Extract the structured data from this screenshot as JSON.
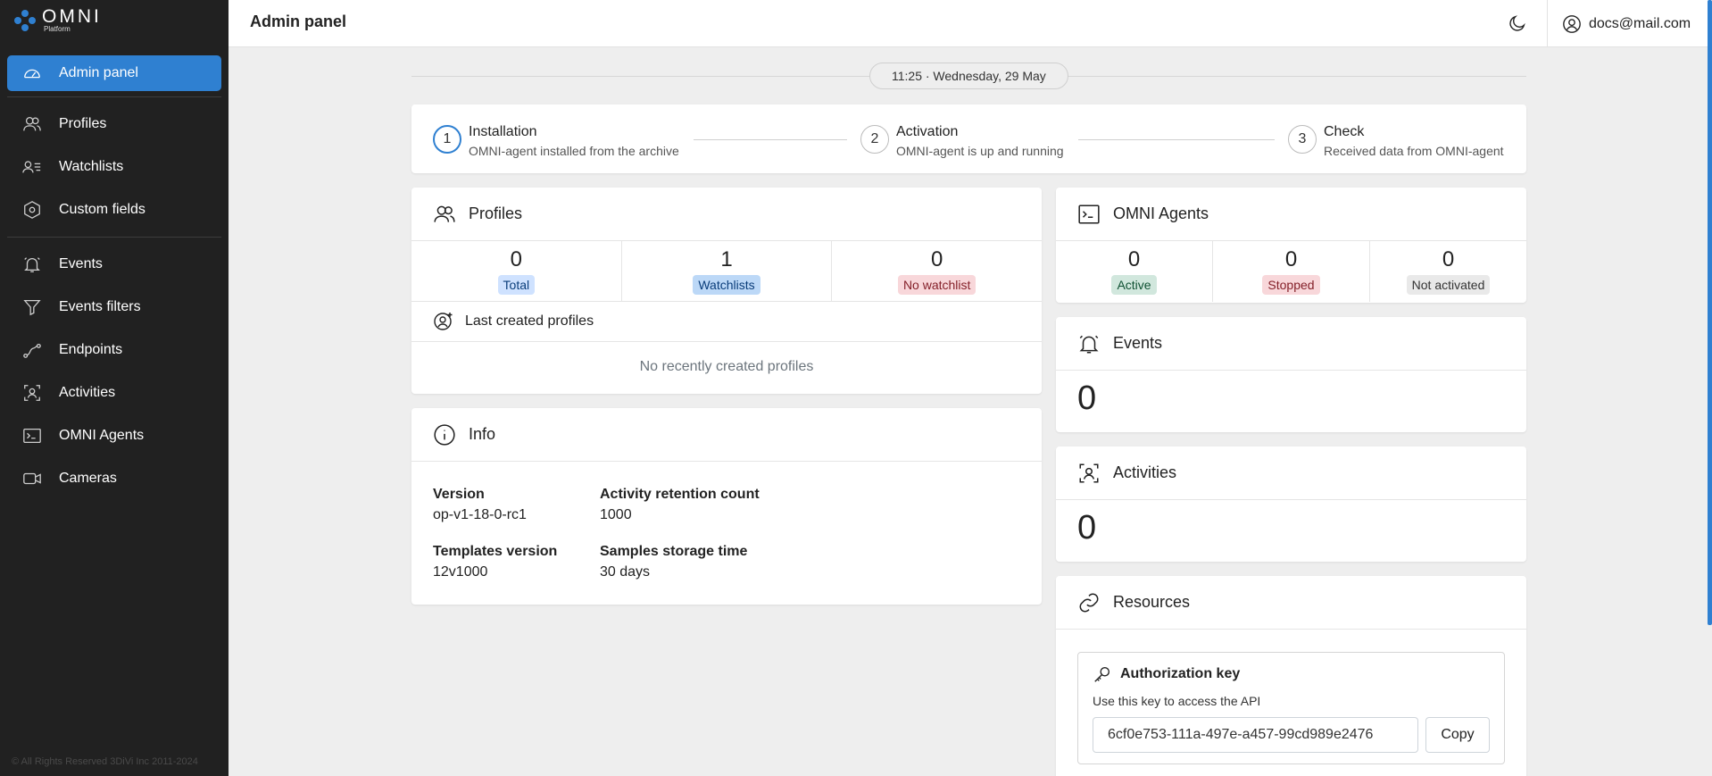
{
  "sidebar": {
    "logo": {
      "name": "OMNI",
      "sub": "Platform"
    },
    "items": [
      {
        "label": "Admin panel",
        "icon": "gauge-icon",
        "active": true
      },
      {
        "label": "Profiles",
        "icon": "users-icon"
      },
      {
        "label": "Watchlists",
        "icon": "list-user-icon"
      },
      {
        "label": "Custom fields",
        "icon": "hexagon-icon"
      },
      {
        "label": "Events",
        "icon": "bell-icon"
      },
      {
        "label": "Events filters",
        "icon": "filter-icon"
      },
      {
        "label": "Endpoints",
        "icon": "route-icon"
      },
      {
        "label": "Activities",
        "icon": "scan-user-icon"
      },
      {
        "label": "OMNI Agents",
        "icon": "terminal-icon"
      },
      {
        "label": "Cameras",
        "icon": "camera-icon"
      }
    ],
    "copyright": "© All Rights Reserved 3DiVi Inc 2011-2024"
  },
  "header": {
    "title": "Admin panel",
    "user": "docs@mail.com"
  },
  "date": "11:25 · Wednesday, 29 May",
  "steps": [
    {
      "num": "1",
      "title": "Installation",
      "sub": "OMNI-agent installed from the archive"
    },
    {
      "num": "2",
      "title": "Activation",
      "sub": "OMNI-agent is up and running"
    },
    {
      "num": "3",
      "title": "Check",
      "sub": "Received data from OMNI-agent"
    }
  ],
  "profiles": {
    "title": "Profiles",
    "stats": [
      {
        "value": "0",
        "label": "Total",
        "bg": "#cfe2ff",
        "fg": "#0a3d7a"
      },
      {
        "value": "1",
        "label": "Watchlists",
        "bg": "#bcd8f7",
        "fg": "#0a3d7a"
      },
      {
        "value": "0",
        "label": "No watchlist",
        "bg": "#f8d7da",
        "fg": "#842029"
      }
    ],
    "last_created": "Last created profiles",
    "empty": "No recently created profiles"
  },
  "info": {
    "title": "Info",
    "version_label": "Version",
    "version": "op-v1-18-0-rc1",
    "retention_label": "Activity retention count",
    "retention": "1000",
    "templates_label": "Templates version",
    "templates": "12v1000",
    "storage_label": "Samples storage time",
    "storage": "30 days"
  },
  "agents": {
    "title": "OMNI Agents",
    "stats": [
      {
        "value": "0",
        "label": "Active",
        "bg": "#d1e7dd",
        "fg": "#0f5132"
      },
      {
        "value": "0",
        "label": "Stopped",
        "bg": "#f8d7da",
        "fg": "#842029"
      },
      {
        "value": "0",
        "label": "Not activated",
        "bg": "#e9e9e9",
        "fg": "#333333"
      }
    ]
  },
  "events": {
    "title": "Events",
    "count": "0"
  },
  "activities": {
    "title": "Activities",
    "count": "0"
  },
  "resources": {
    "title": "Resources",
    "auth_title": "Authorization key",
    "auth_desc": "Use this key to access the API",
    "key": "6cf0e753-111a-497e-a457-99cd989e2476",
    "copy": "Copy"
  },
  "accent": "#2f80d1"
}
